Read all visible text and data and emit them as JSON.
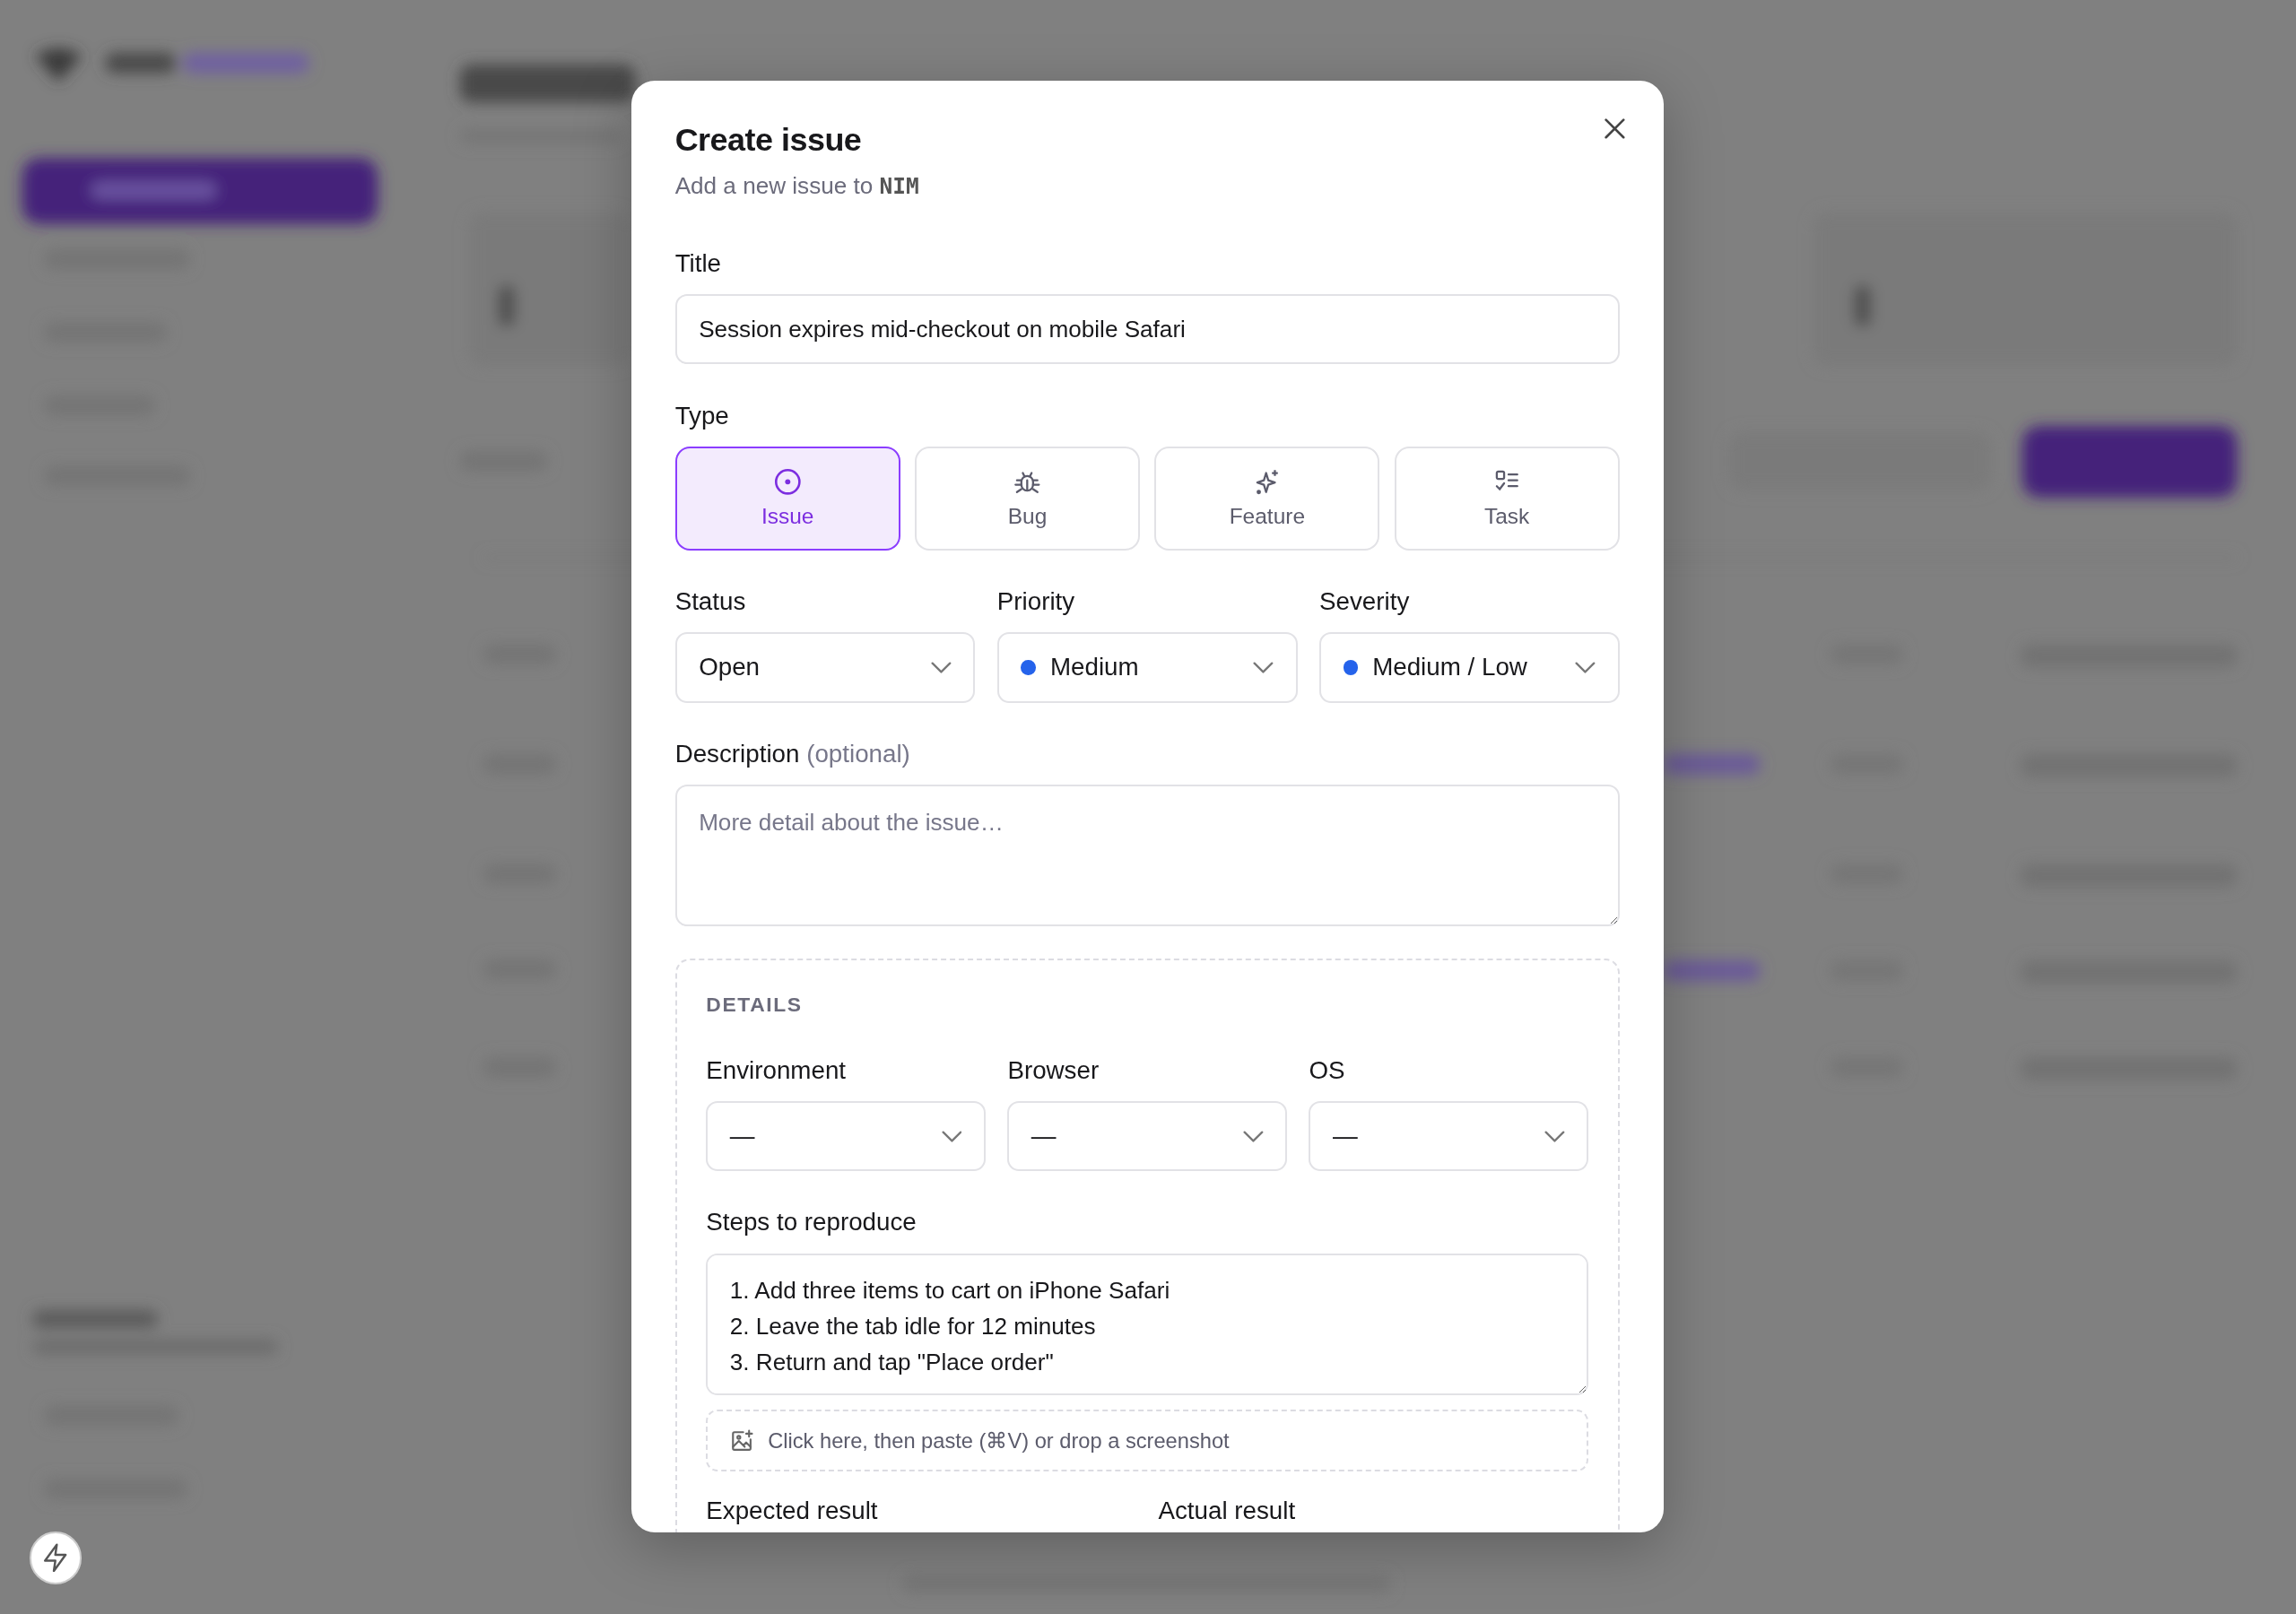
{
  "dialog": {
    "title": "Create issue",
    "subtitle": "Add a new issue to",
    "project_key": "NIM",
    "title_field": {
      "label": "Title",
      "value": "Session expires mid-checkout on mobile Safari"
    },
    "type": {
      "label": "Type",
      "options": [
        {
          "label": "Issue",
          "kind": "issue",
          "selected": true
        },
        {
          "label": "Bug",
          "kind": "bug",
          "selected": false
        },
        {
          "label": "Feature",
          "kind": "feature",
          "selected": false
        },
        {
          "label": "Task",
          "kind": "task",
          "selected": false
        }
      ]
    },
    "selects": [
      {
        "label": "Status",
        "value": "Open"
      },
      {
        "label": "Priority",
        "value": "Medium",
        "color": "#2563eb"
      },
      {
        "label": "Severity",
        "value": "Medium / Low",
        "color": "#2563eb"
      }
    ],
    "description": {
      "label": "Description",
      "hint": "(optional)",
      "placeholder": "More detail about the issue…"
    },
    "details": {
      "heading": "DETAILS",
      "selects": [
        {
          "label": "Environment",
          "value": "—"
        },
        {
          "label": "Browser",
          "value": "—"
        },
        {
          "label": "OS",
          "value": "—"
        }
      ],
      "steps": {
        "label": "Steps to reproduce",
        "value": "1. Add three items to cart on iPhone Safari\n2. Leave the tab idle for 12 minutes\n3. Return and tap \"Place order\""
      },
      "paste_hint": "Click here, then paste (⌘V) or drop a screenshot",
      "result_labels": [
        "Expected result",
        "Actual result"
      ]
    }
  }
}
